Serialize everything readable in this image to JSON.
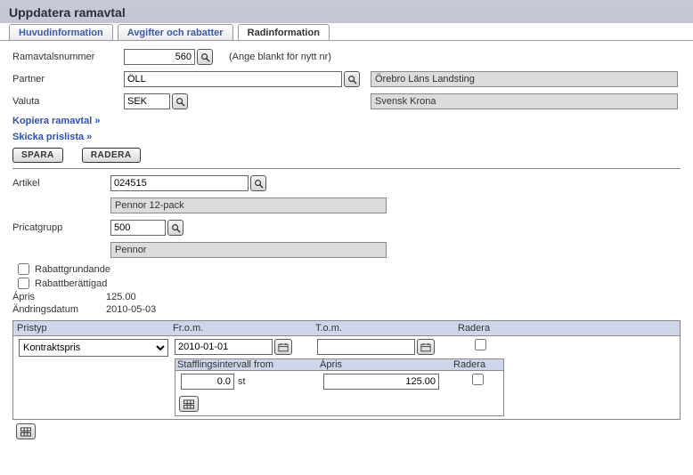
{
  "header": {
    "title": "Uppdatera ramavtal"
  },
  "tabs": [
    {
      "label": "Huvudinformation"
    },
    {
      "label": "Avgifter och rabatter"
    },
    {
      "label": "Radinformation",
      "active": true
    }
  ],
  "fields": {
    "ramavtalsnummer_label": "Ramavtalsnummer",
    "ramavtalsnummer_value": "560",
    "ramavtalsnummer_hint": "(Ange blankt för nytt nr)",
    "partner_label": "Partner",
    "partner_value": "ÖLL",
    "partner_name": "Örebro Läns Landsting",
    "valuta_label": "Valuta",
    "valuta_value": "SEK",
    "valuta_name": "Svensk Krona"
  },
  "links": {
    "kopiera": "Kopiera ramavtal »",
    "skicka": "Skicka prislista »"
  },
  "buttons": {
    "spara": "SPARA",
    "radera": "RADERA"
  },
  "artikel": {
    "label": "Artikel",
    "code": "024515",
    "name": "Pennor 12-pack"
  },
  "pricatgrupp": {
    "label": "Pricatgrupp",
    "code": "500",
    "name": "Pennor"
  },
  "checks": {
    "rabattgrundande": "Rabattgrundande",
    "rabattberattigad": "Rabattberättigad"
  },
  "apris": {
    "label": "Ápris",
    "value": "125.00"
  },
  "andringsdatum": {
    "label": "Ändringsdatum",
    "value": "2010-05-03"
  },
  "pristable": {
    "headers": {
      "pristyp": "Pristyp",
      "from": "Fr.o.m.",
      "tom": "T.o.m.",
      "radera": "Radera"
    },
    "row": {
      "pristyp": "Kontraktspris",
      "from": "2010-01-01",
      "tom": ""
    }
  },
  "stafftable": {
    "headers": {
      "intervall": "Stafflingsintervall from",
      "apris": "Ápris",
      "radera": "Radera"
    },
    "row": {
      "intervall": "0.0",
      "unit": "st",
      "apris": "125.00"
    }
  }
}
